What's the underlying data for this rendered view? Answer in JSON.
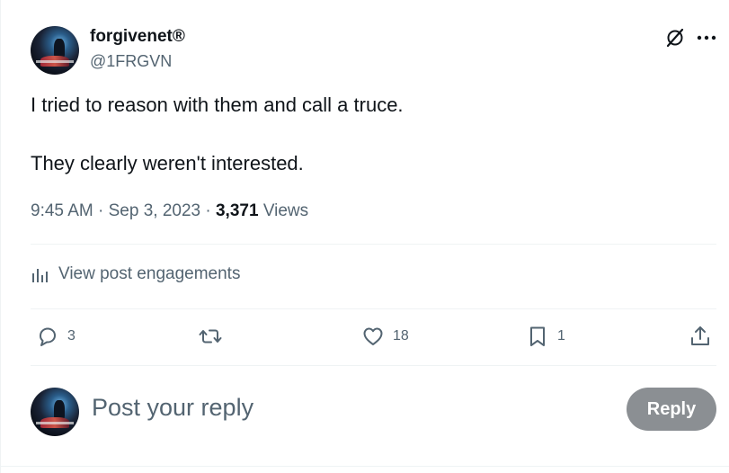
{
  "author": {
    "display_name": "forgivenet®",
    "handle": "@1FRGVN"
  },
  "tweet": {
    "line1": "I tried to reason with them and call a truce.",
    "line2": "They clearly weren't interested."
  },
  "meta": {
    "time": "9:45 AM",
    "date": "Sep 3, 2023",
    "views_count": "3,371",
    "views_label": "Views"
  },
  "engagements_label": "View post engagements",
  "actions": {
    "reply_count": "3",
    "retweet_count": "",
    "like_count": "18",
    "bookmark_count": "1"
  },
  "reply_box": {
    "placeholder": "Post your reply",
    "button_label": "Reply"
  },
  "icons": {
    "grok": "grok-icon",
    "more": "more-icon",
    "engagements": "analytics-icon",
    "reply": "reply-icon",
    "retweet": "retweet-icon",
    "like": "heart-icon",
    "bookmark": "bookmark-icon",
    "share": "share-icon"
  },
  "colors": {
    "text_primary": "#0f1419",
    "text_secondary": "#536471",
    "divider": "#eff3f4",
    "reply_button_bg": "#8b8f93"
  }
}
